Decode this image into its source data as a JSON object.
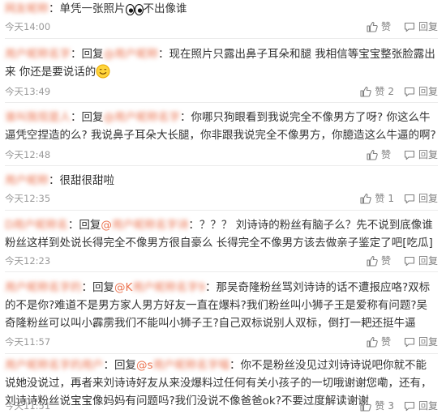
{
  "labels": {
    "like": "赞",
    "reply": "回复"
  },
  "comments": [
    {
      "username": "网友昵称",
      "text_after": "：单凭一张照片",
      "text_end": "不出像谁",
      "time": "今天14:00",
      "like_count": ""
    },
    {
      "username": "用户昵称名字",
      "reply_prefix": "：回复",
      "mention": "@用户昵称",
      "text": "：现在照片只露出鼻子耳朵和腿 我相信等宝宝整张脸露出来 你还是要说话的",
      "time": "今天13:49",
      "like_count": "2"
    },
    {
      "username": "谁叫我现是人",
      "reply_prefix": "：回复",
      "mention": "@用户昵称名字",
      "text": "：你哪只狗眼看到我说完全不像男方了呀? 你这么牛逼凭空捏造的么? 我说鼻子耳朵大长腿，你非跟我说完全不像男方，你臆造这么牛逼的啊?",
      "time": "今天12:48",
      "like_count": ""
    },
    {
      "username": "用户昵称",
      "text": "：很甜很甜啦",
      "time": "今天12:35",
      "like_count": "1"
    },
    {
      "username": "D用户昵称名",
      "reply_prefix": "：回复",
      "mention_visible": "@",
      "mention": "用户昵称名字诗",
      "text": "：？？？ 刘诗诗的粉丝有脑子么？先不说到底像谁 粉丝这样到处说长得完全不像男方很自豪么 长得完全不像男方该去做亲子鉴定了吧[吃瓜]",
      "time": "今天12:23",
      "like_count": ""
    },
    {
      "username": "用户昵称名字的",
      "reply_prefix": "：回复",
      "mention_visible": "@K",
      "mention": "用户昵称名字9",
      "text": "：那吴奇隆粉丝骂刘诗诗的话不遭报应咯?双标的不是你?难道不是男方家人男方好友一直在爆料?我们粉丝叫小狮子王是爱称有问题?吴奇隆粉丝可以叫小霹雳我们不能叫小狮子王?自己双标说别人双标，倒打一耙还挺牛逼",
      "time": "今天11:57",
      "like_count": ""
    },
    {
      "username": "用户昵称名字的用户",
      "reply_prefix": "：回复",
      "mention_visible": "@s",
      "mention": "用户昵称名字喵",
      "text": "：你不是粉丝没见过刘诗诗说吧你就不能说她没说过，再者来刘诗诗好友从来没爆料过任何有关小孩子的一切哦谢谢您嘞，还有，刘诗诗粉丝说宝宝像妈妈有问题吗?我们没说不像爸爸ok?不要过度解读谢谢",
      "time": "今天11:51",
      "like_count": "3"
    }
  ]
}
